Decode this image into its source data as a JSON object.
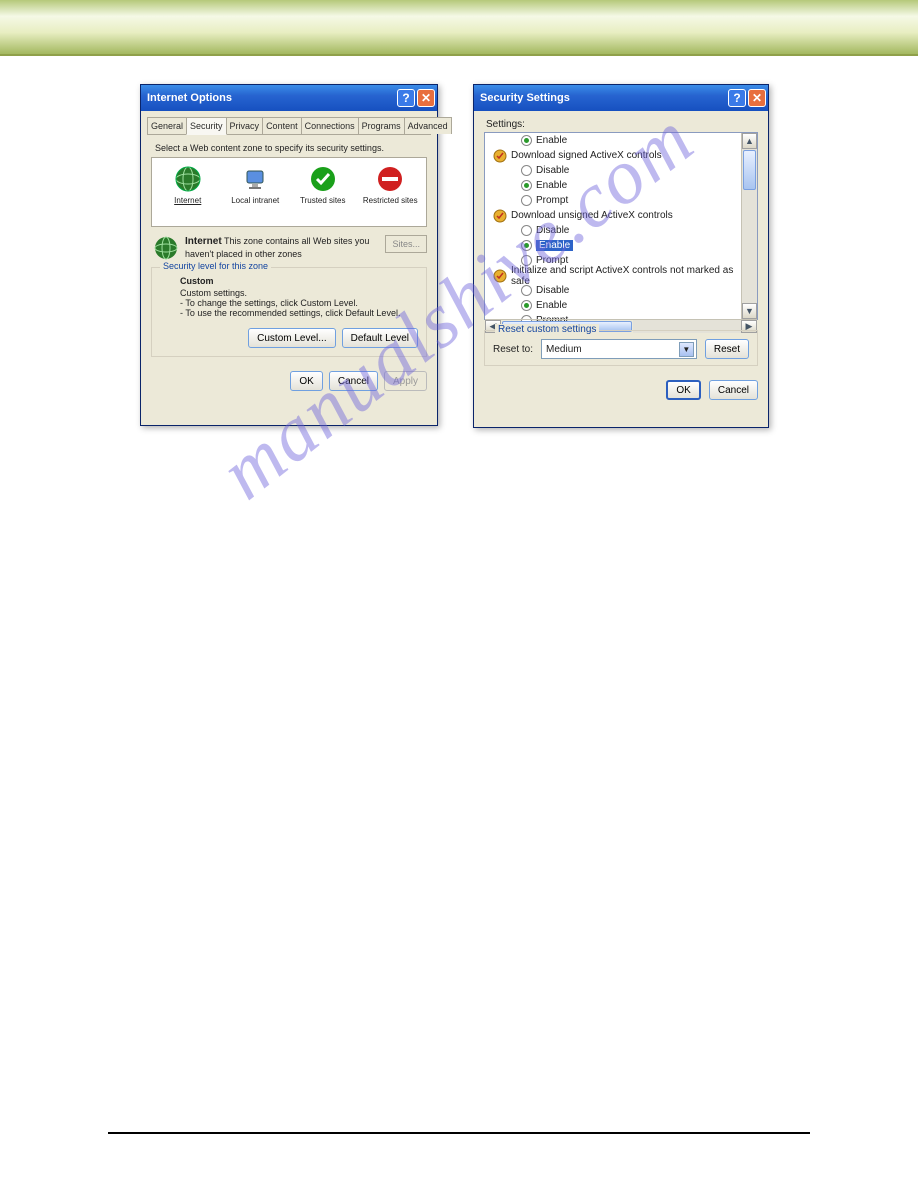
{
  "watermark": "manualshive.com",
  "internet_options": {
    "title": "Internet Options",
    "tabs": [
      "General",
      "Security",
      "Privacy",
      "Content",
      "Connections",
      "Programs",
      "Advanced"
    ],
    "active_tab": "Security",
    "instruction": "Select a Web content zone to specify its security settings.",
    "zones": [
      {
        "label": "Internet",
        "selected": true
      },
      {
        "label": "Local intranet"
      },
      {
        "label": "Trusted sites"
      },
      {
        "label": "Restricted sites"
      }
    ],
    "zone_desc_title": "Internet",
    "zone_desc_text": "This zone contains all Web sites you haven't placed in other zones",
    "sites_btn": "Sites...",
    "sec_level_legend": "Security level for this zone",
    "custom_title": "Custom",
    "custom_sub": "Custom settings.",
    "custom_l1": "- To change the settings, click Custom Level.",
    "custom_l2": "- To use the recommended settings, click Default Level.",
    "btn_custom": "Custom Level...",
    "btn_default": "Default Level",
    "btn_ok": "OK",
    "btn_cancel": "Cancel",
    "btn_apply": "Apply"
  },
  "security_settings": {
    "title": "Security Settings",
    "settings_label": "Settings:",
    "tree": [
      {
        "type": "radio",
        "label": "Enable",
        "checked": true,
        "indent": 1
      },
      {
        "type": "cat",
        "label": "Download signed ActiveX controls"
      },
      {
        "type": "radio",
        "label": "Disable",
        "checked": false,
        "indent": 1
      },
      {
        "type": "radio",
        "label": "Enable",
        "checked": true,
        "indent": 1
      },
      {
        "type": "radio",
        "label": "Prompt",
        "checked": false,
        "indent": 1
      },
      {
        "type": "cat",
        "label": "Download unsigned ActiveX controls"
      },
      {
        "type": "radio",
        "label": "Disable",
        "checked": false,
        "indent": 1
      },
      {
        "type": "radio",
        "label": "Enable",
        "checked": true,
        "indent": 1,
        "selected": true
      },
      {
        "type": "radio",
        "label": "Prompt",
        "checked": false,
        "indent": 1
      },
      {
        "type": "cat",
        "label": "Initialize and script ActiveX controls not marked as safe"
      },
      {
        "type": "radio",
        "label": "Disable",
        "checked": false,
        "indent": 1
      },
      {
        "type": "radio",
        "label": "Enable",
        "checked": true,
        "indent": 1
      },
      {
        "type": "radio",
        "label": "Prompt",
        "checked": false,
        "indent": 1
      }
    ],
    "reset_legend": "Reset custom settings",
    "reset_label": "Reset to:",
    "reset_value": "Medium",
    "btn_reset": "Reset",
    "btn_ok": "OK",
    "btn_cancel": "Cancel"
  }
}
